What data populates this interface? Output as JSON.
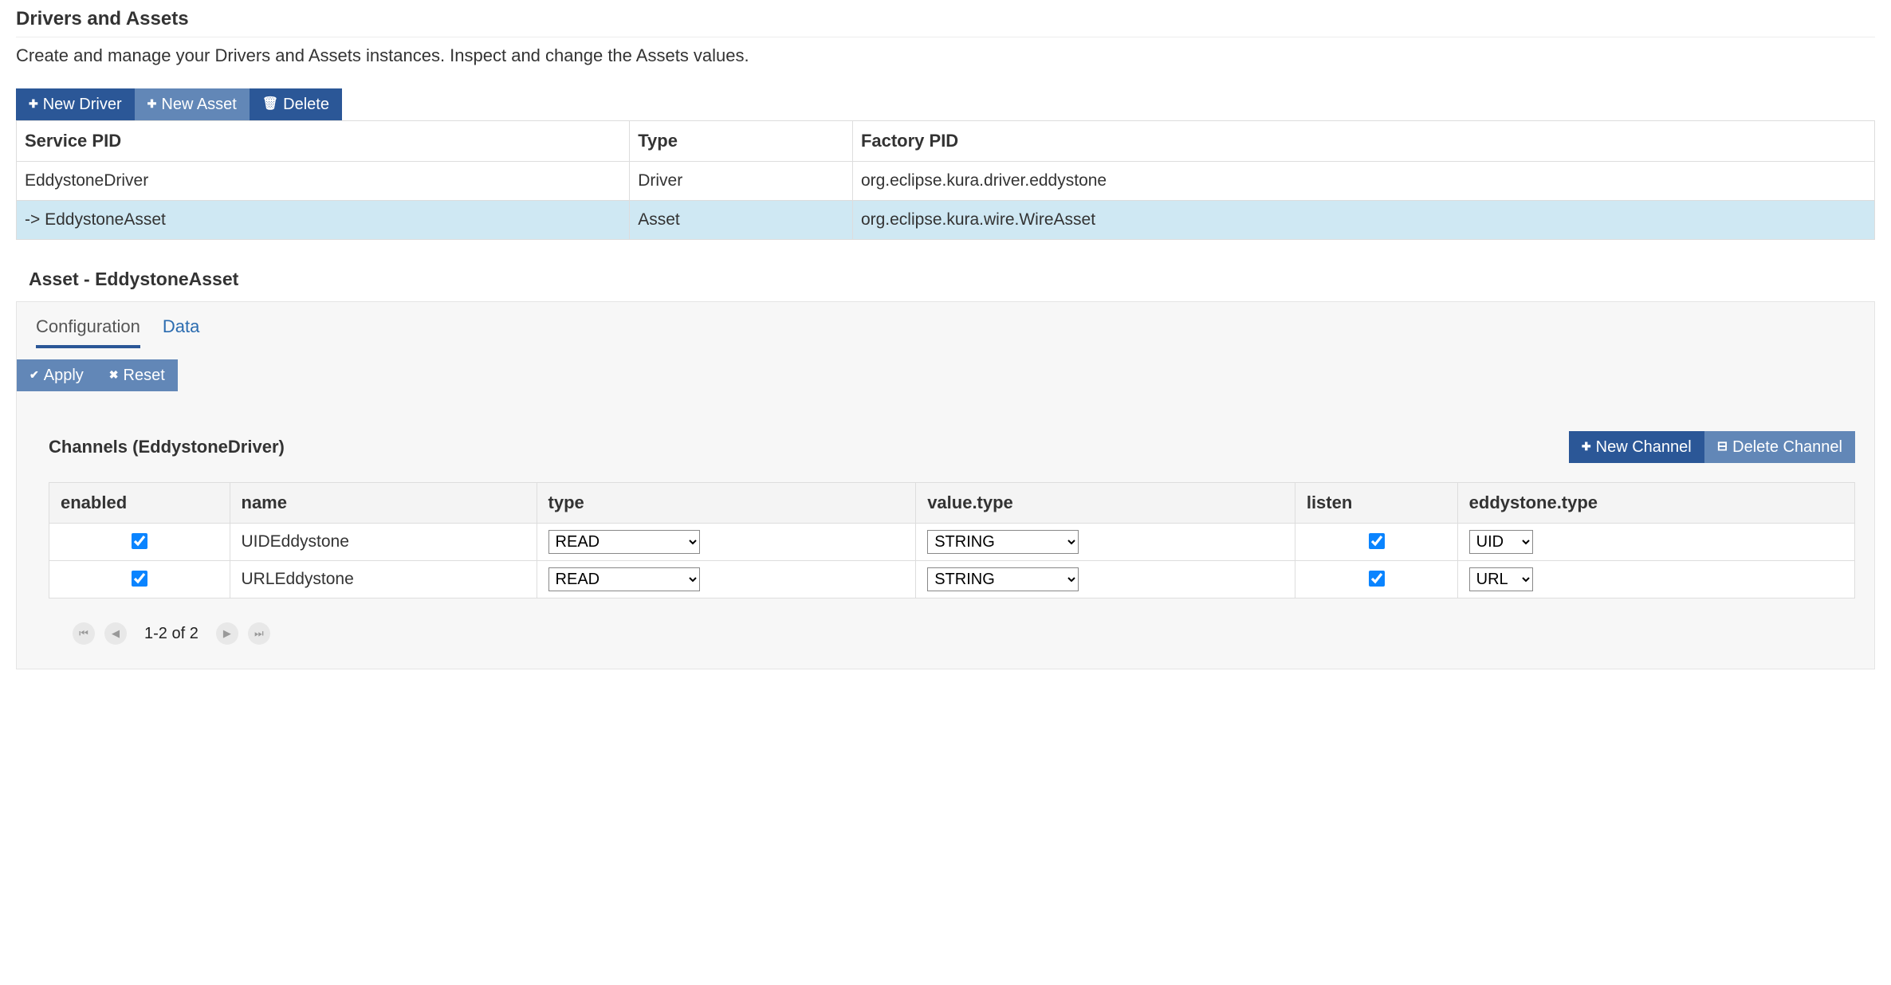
{
  "header": {
    "title": "Drivers and Assets",
    "subtitle": "Create and manage your Drivers and Assets instances. Inspect and change the Assets values."
  },
  "toolbar": {
    "new_driver": "New Driver",
    "new_asset": "New Asset",
    "delete": "Delete"
  },
  "table": {
    "columns": {
      "service_pid": "Service PID",
      "type": "Type",
      "factory_pid": "Factory PID"
    },
    "rows": [
      {
        "service_pid": "EddystoneDriver",
        "type": "Driver",
        "factory_pid": "org.eclipse.kura.driver.eddystone",
        "selected": false
      },
      {
        "service_pid": "-> EddystoneAsset",
        "type": "Asset",
        "factory_pid": "org.eclipse.kura.wire.WireAsset",
        "selected": true
      }
    ]
  },
  "asset": {
    "heading": "Asset - EddystoneAsset",
    "tabs": {
      "configuration": "Configuration",
      "data": "Data"
    },
    "actions": {
      "apply": "Apply",
      "reset": "Reset"
    }
  },
  "channels": {
    "title": "Channels (EddystoneDriver)",
    "buttons": {
      "new": "New Channel",
      "delete": "Delete Channel"
    },
    "columns": {
      "enabled": "enabled",
      "name": "name",
      "type": "type",
      "value_type": "value.type",
      "listen": "listen",
      "eddystone_type": "eddystone.type"
    },
    "rows": [
      {
        "enabled": true,
        "name": "UIDEddystone",
        "type": "READ",
        "value_type": "STRING",
        "listen": true,
        "eddystone_type": "UID"
      },
      {
        "enabled": true,
        "name": "URLEddystone",
        "type": "READ",
        "value_type": "STRING",
        "listen": true,
        "eddystone_type": "URL"
      }
    ],
    "type_options": [
      "READ"
    ],
    "value_type_options": [
      "STRING"
    ],
    "eddystone_type_options": [
      "UID",
      "URL"
    ]
  },
  "pager": {
    "info": "1-2 of 2"
  }
}
